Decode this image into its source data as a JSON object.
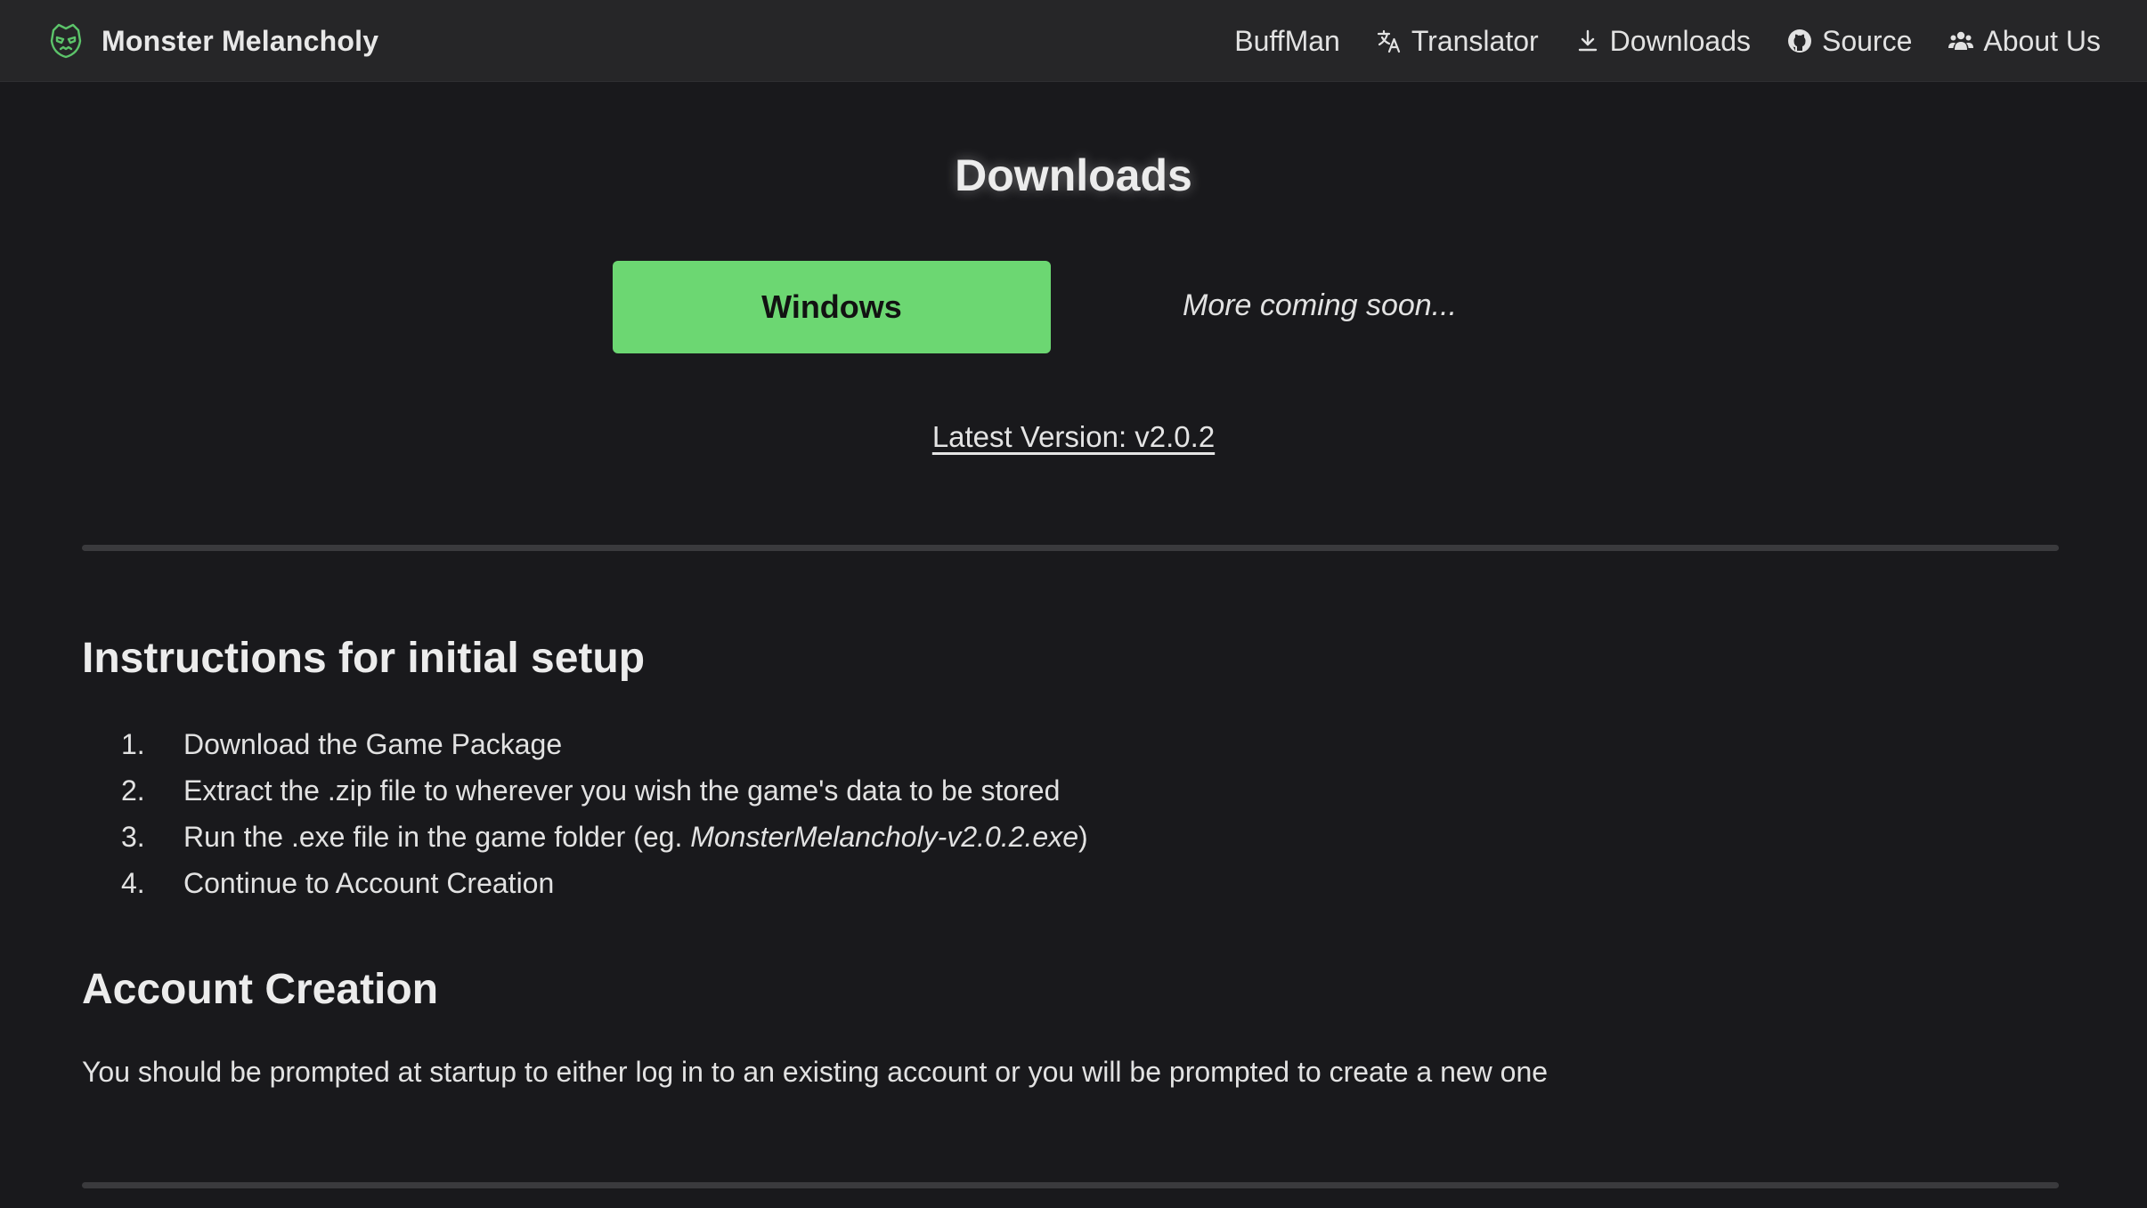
{
  "brand": {
    "name": "Monster Melancholy",
    "logo_icon": "monster-face-icon",
    "logo_color": "#5cc46a"
  },
  "nav": {
    "items": [
      {
        "label": "BuffMan",
        "icon": ""
      },
      {
        "label": "Translator",
        "icon": "translate-icon"
      },
      {
        "label": "Downloads",
        "icon": "download-icon"
      },
      {
        "label": "Source",
        "icon": "github-icon"
      },
      {
        "label": "About Us",
        "icon": "users-icon"
      }
    ]
  },
  "downloads": {
    "title": "Downloads",
    "windows_label": "Windows",
    "windows_color": "#6cd772",
    "coming_soon": "More coming soon...",
    "version_label": "Latest Version: v2.0.2"
  },
  "instructions": {
    "heading": "Instructions for initial setup",
    "steps": [
      {
        "num": "1.",
        "text": "Download the Game Package",
        "em": "",
        "suffix": ""
      },
      {
        "num": "2.",
        "text": "Extract the .zip file to wherever you wish the game's data to be stored",
        "em": "",
        "suffix": ""
      },
      {
        "num": "3.",
        "text": "Run the .exe file in the game folder (eg. ",
        "em": "MonsterMelancholy-v2.0.2.exe",
        "suffix": ")"
      },
      {
        "num": "4.",
        "text": "Continue to Account Creation",
        "em": "",
        "suffix": ""
      }
    ]
  },
  "account": {
    "heading": "Account Creation",
    "text": "You should be prompted at startup to either log in to an existing account or you will be prompted to create a new one"
  }
}
